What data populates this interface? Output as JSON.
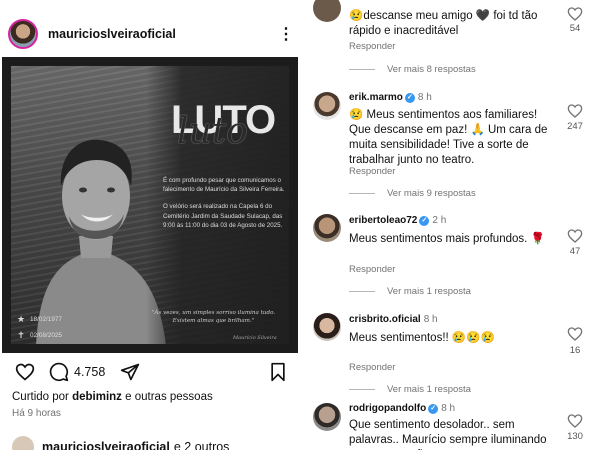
{
  "post": {
    "username": "mauricioslveiraoficial",
    "card": {
      "title_block": "LUTO",
      "title_script": "luto",
      "paragraph1": "É com profundo pesar que comunicamos o falecimento de Maurício da Silveira Ferreira.",
      "paragraph2": "O velório será realizado na Capela 6 do Cemitério Jardim da Saudade Sulacap, das 9:00 às 11:00 do dia 03 de Agosto de 2025.",
      "quote": "\"Às vezes, um simples sorriso ilumina tudo. Existem almas que brilham.\"",
      "quote_signature": "Maurício Silveira",
      "birth_date": "18/02/1977",
      "death_date": "02/08/2025"
    },
    "comment_count": "4.758",
    "liked_prefix": "Curtido por",
    "liked_user": "debiminz",
    "liked_suffix": "e outras pessoas",
    "time_ago": "Há 9 horas",
    "bottom_user": "mauricioslveiraoficial",
    "bottom_suffix": "e 2 outros"
  },
  "comments": [
    {
      "username": "",
      "time": "",
      "text": "😢descanse meu amigo 🖤 foi td tão rápido e inacreditável",
      "reply_label": "Responder",
      "more_replies": "Ver mais 8 respostas",
      "likes": "54",
      "verified": false
    },
    {
      "username": "erik.marmo",
      "time": "8 h",
      "text": "😢 Meus sentimentos aos familiares! Que descanse em paz! 🙏 Um cara de muita sensibilidade! Tive a sorte de trabalhar junto no teatro.",
      "reply_label": "Responder",
      "more_replies": "Ver mais 9 respostas",
      "likes": "247",
      "verified": true
    },
    {
      "username": "eribertoleao72",
      "time": "2 h",
      "text": "Meus sentimentos mais profundos. 🌹",
      "reply_label": "Responder",
      "more_replies": "Ver mais 1 resposta",
      "likes": "47",
      "verified": true
    },
    {
      "username": "crisbrito.oficial",
      "time": "8 h",
      "text": "Meus sentimentos!! 😢😢😢",
      "reply_label": "Responder",
      "more_replies": "Ver mais 1 resposta",
      "likes": "16",
      "verified": false
    },
    {
      "username": "rodrigopandolfo",
      "time": "8 h",
      "text": "Que sentimento desolador.. sem palavras.. Maurício sempre iluminando nossos corações",
      "reply_label": "",
      "more_replies": "",
      "likes": "130",
      "verified": true
    }
  ],
  "icons": {
    "like": "heart-outline-icon",
    "comment": "speech-bubble-icon",
    "share": "paper-plane-icon",
    "save": "bookmark-icon",
    "more": "more-options-icon",
    "birth": "star-icon",
    "death": "cross-icon"
  },
  "colors": {
    "verified": "#3897f0",
    "muted_text": "#737373",
    "story_ring": "#d6249f"
  }
}
